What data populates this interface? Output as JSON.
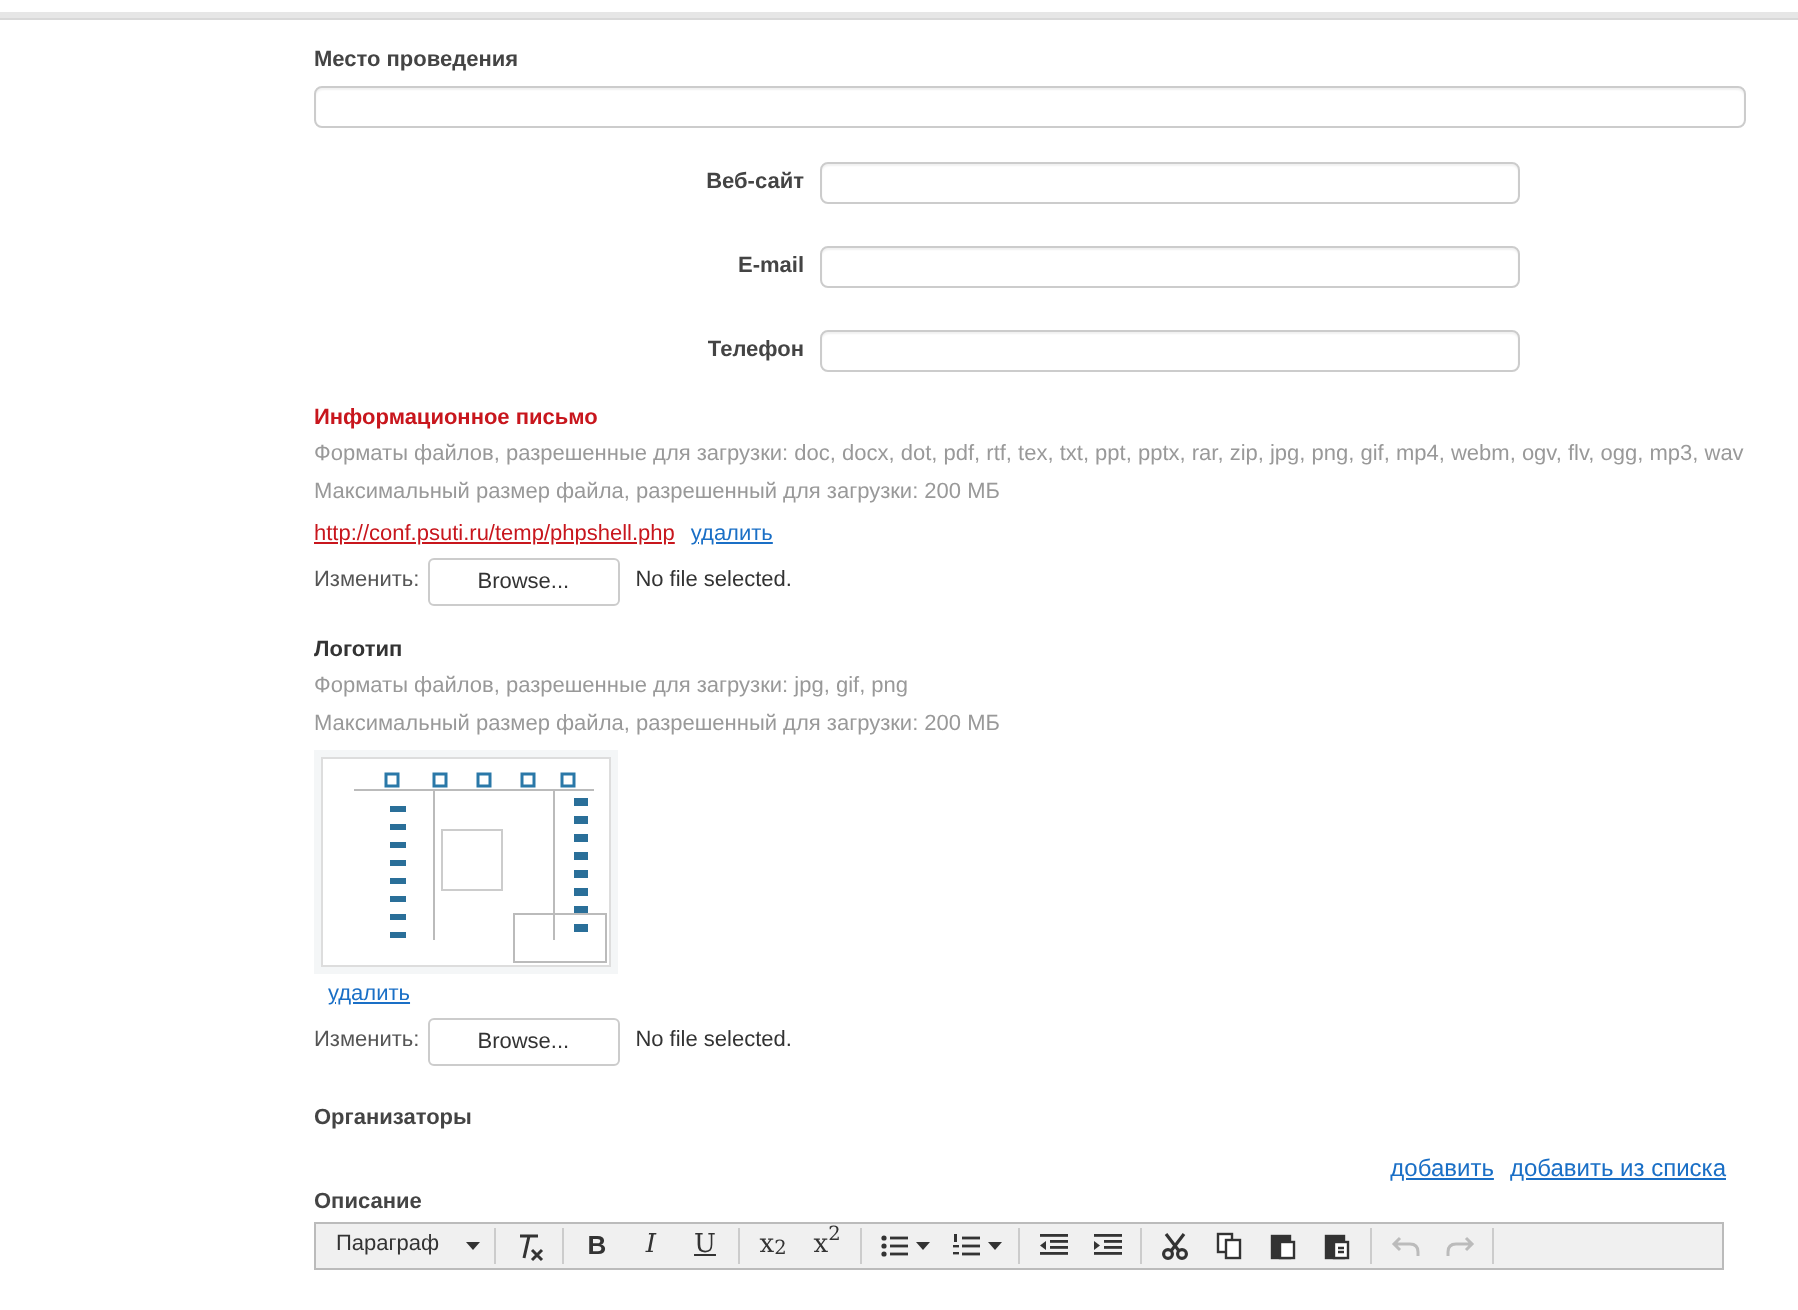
{
  "venue": {
    "label": "Место проведения"
  },
  "contacts": [
    {
      "label": "Веб-сайт"
    },
    {
      "label": "E-mail"
    },
    {
      "label": "Телефон"
    }
  ],
  "files": [
    {
      "title": "Информационное письмо",
      "error": true,
      "formats": "Форматы файлов, разрешенные для загрузки: doc, docx, dot, pdf, rtf, tex, txt, ppt, pptx, rar, zip, jpg, png, gif, mp4, webm, ogv, flv, ogg, mp3, wav",
      "max_size": "Максимальный размер файла, разрешенный для загрузки: 200 МБ",
      "current": {
        "kind": "link",
        "url": "http://conf.psuti.ru/temp/phpshell.php"
      },
      "delete_label": "удалить",
      "change_label": "Изменить:",
      "browse_label": "Browse...",
      "no_file_text": "No file selected."
    },
    {
      "title": "Логотип",
      "error": false,
      "formats": "Форматы файлов, разрешенные для загрузки: jpg, gif, png",
      "max_size": "Максимальный размер файла, разрешенный для загрузки: 200 МБ",
      "delete_label": "удалить",
      "change_label": "Изменить:",
      "browse_label": "Browse...",
      "no_file_text": "No file selected."
    }
  ],
  "organizers": {
    "label": "Организаторы",
    "actions": [
      "добавить",
      "добавить из списка"
    ]
  },
  "description": {
    "label": "Описание",
    "toolbar": [
      [
        {
          "kind": "dropdown",
          "label": "Параграф",
          "disabled": false
        }
      ],
      [
        {
          "kind": "clear-format",
          "disabled": false
        }
      ],
      [
        {
          "kind": "bold",
          "label": "B",
          "disabled": false
        },
        {
          "kind": "italic",
          "label": "I",
          "disabled": false
        },
        {
          "kind": "underline",
          "label": "U",
          "disabled": false
        }
      ],
      [
        {
          "kind": "subscript",
          "label": "x$_{2}$",
          "disabled": false
        },
        {
          "kind": "superscript",
          "label": "x$^{2}$",
          "disabled": false
        }
      ],
      [
        {
          "kind": "bullet-list",
          "disabled": false
        },
        {
          "kind": "number-list",
          "disabled": false
        }
      ],
      [
        {
          "kind": "outdent",
          "disabled": false
        },
        {
          "kind": "indent",
          "disabled": false
        }
      ],
      [
        {
          "kind": "cut",
          "disabled": false
        },
        {
          "kind": "copy",
          "disabled": false
        },
        {
          "kind": "paste",
          "disabled": false
        },
        {
          "kind": "paste-text",
          "disabled": false
        }
      ],
      [
        {
          "kind": "undo",
          "disabled": true
        },
        {
          "kind": "redo",
          "disabled": true
        }
      ]
    ]
  }
}
